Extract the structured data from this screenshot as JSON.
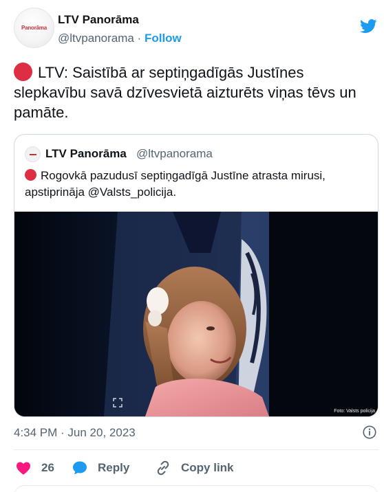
{
  "author": {
    "name": "LTV Panorāma",
    "handle": "@ltvpanorama",
    "separator": "·",
    "follow_label": "Follow",
    "avatar_text": "Panorāma"
  },
  "tweet": {
    "text": "LTV: Saistībā ar septiņgadīgās Justīnes slepkavību savā dzīvesvietā aizturēts viņas tēvs un pamāte."
  },
  "quoted": {
    "name": "LTV Panorāma",
    "handle": "@ltvpanorama",
    "text": "Rogovkā pazudusī septiņgadīgā Justīne atrasta mirusi, apstiprināja @Valsts_policija.",
    "photo_credit": "Foto: Valsts policija"
  },
  "meta": {
    "timestamp": "4:34 PM · Jun 20, 2023"
  },
  "actions": {
    "like_count": "26",
    "reply_label": "Reply",
    "copy_label": "Copy link"
  },
  "icons": {
    "brand": "twitter-bird-icon",
    "like": "heart-icon",
    "reply": "speech-bubble-icon",
    "copy": "link-icon",
    "info": "info-icon"
  },
  "colors": {
    "brand_blue": "#1d9bf0",
    "like_pink": "#f91880",
    "red_circle": "#dd2e44",
    "secondary_text": "#536471"
  }
}
